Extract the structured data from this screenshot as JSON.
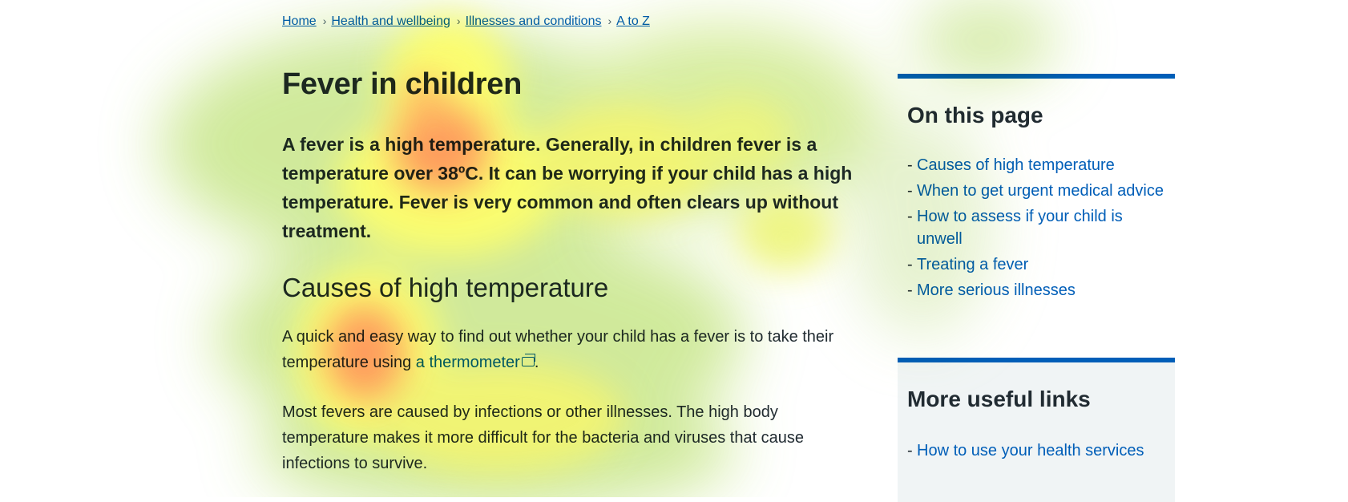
{
  "breadcrumb": {
    "items": [
      "Home",
      "Health and wellbeing",
      "Illnesses and conditions",
      "A to Z"
    ],
    "separator": "›"
  },
  "page_title": "Fever in children",
  "lede": "A fever is a high temperature. Generally, in children fever is a temperature over 38ºC. It can be worrying if your child has a high temperature. Fever is very common and often clears up without treatment.",
  "section": {
    "heading": "Causes of high temperature",
    "para1_before": "A quick and easy way to find out whether your child has a fever is to take their temperature using ",
    "para1_link": "a thermometer",
    "para1_after": ".",
    "para2": "Most fevers are caused by infections or other illnesses. The high body temperature makes it more difficult for the bacteria and viruses that cause infections to survive."
  },
  "on_this_page": {
    "title": "On this page",
    "links": [
      "Causes of high temperature",
      "When to get urgent medical advice",
      "How to assess if your child is unwell",
      "Treating a fever",
      "More serious illnesses"
    ]
  },
  "more_useful_links": {
    "title": "More useful links",
    "links": [
      "How to use your health services"
    ]
  },
  "colors": {
    "link": "#005eb8",
    "text": "#212b32",
    "panel_border": "#005eb8",
    "panel_bg": "#f0f4f5",
    "heat_hot": "#ff7f50",
    "heat_warm": "#ffff66",
    "heat_cool": "#b8e07a"
  }
}
